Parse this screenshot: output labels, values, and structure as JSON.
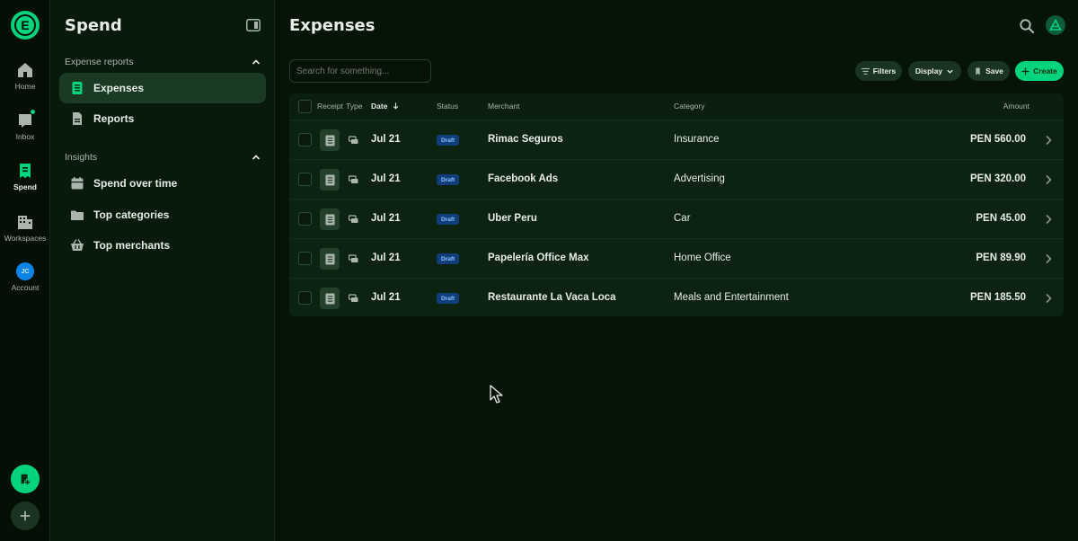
{
  "rail": {
    "logo_letter": "E",
    "items": [
      {
        "label": "Home",
        "icon": "home-icon"
      },
      {
        "label": "Inbox",
        "icon": "inbox-icon"
      },
      {
        "label": "Spend",
        "icon": "receipt-icon"
      },
      {
        "label": "Workspaces",
        "icon": "building-icon"
      },
      {
        "label": "Account",
        "icon": "avatar",
        "initials": "JC"
      }
    ],
    "fab_primary_icon": "new-expense-icon",
    "fab_secondary_icon": "plus-icon"
  },
  "sidebar": {
    "title": "Spend",
    "sections": [
      {
        "heading": "Expense reports",
        "items": [
          {
            "label": "Expenses",
            "icon": "receipt-icon",
            "active": true
          },
          {
            "label": "Reports",
            "icon": "document-icon",
            "active": false
          }
        ]
      },
      {
        "heading": "Insights",
        "items": [
          {
            "label": "Spend over time",
            "icon": "calendar-icon",
            "active": false
          },
          {
            "label": "Top categories",
            "icon": "folder-icon",
            "active": false
          },
          {
            "label": "Top merchants",
            "icon": "basket-icon",
            "active": false
          }
        ]
      }
    ]
  },
  "main": {
    "title": "Expenses",
    "search_placeholder": "Search for something...",
    "toolbar": {
      "filters": "Filters",
      "display": "Display",
      "save": "Save",
      "create": "Create"
    },
    "table": {
      "headers": {
        "receipt": "Receipt",
        "type": "Type",
        "date": "Date",
        "status": "Status",
        "merchant": "Merchant",
        "category": "Category",
        "amount": "Amount"
      },
      "rows": [
        {
          "date": "Jul 21",
          "status": "Draft",
          "merchant": "Rimac Seguros",
          "category": "Insurance",
          "amount": "PEN 560.00"
        },
        {
          "date": "Jul 21",
          "status": "Draft",
          "merchant": "Facebook Ads",
          "category": "Advertising",
          "amount": "PEN 320.00"
        },
        {
          "date": "Jul 21",
          "status": "Draft",
          "merchant": "Uber Peru",
          "category": "Car",
          "amount": "PEN 45.00"
        },
        {
          "date": "Jul 21",
          "status": "Draft",
          "merchant": "Papelería Office Max",
          "category": "Home Office",
          "amount": "PEN 89.90"
        },
        {
          "date": "Jul 21",
          "status": "Draft",
          "merchant": "Restaurante La Vaca Loca",
          "category": "Meals and Entertainment",
          "amount": "PEN 185.50"
        }
      ]
    }
  },
  "colors": {
    "accent": "#03d47c",
    "background": "#061407",
    "sidebar": "#071a0b",
    "badge_bg": "#103e7a",
    "badge_text": "#8cc0ff"
  }
}
